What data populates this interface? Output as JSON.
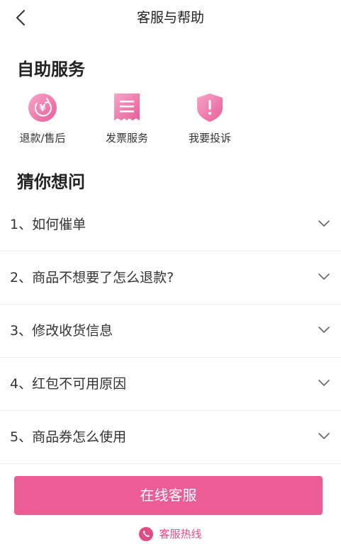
{
  "header": {
    "title": "客服与帮助"
  },
  "self_service": {
    "title": "自助服务",
    "items": [
      {
        "label": "退款/售后",
        "icon": "refund-icon"
      },
      {
        "label": "发票服务",
        "icon": "invoice-icon"
      },
      {
        "label": "我要投诉",
        "icon": "complaint-shield-icon"
      }
    ]
  },
  "faq": {
    "title": "猜你想问",
    "items": [
      {
        "text": "1、如何催单"
      },
      {
        "text": "2、商品不想要了怎么退款?"
      },
      {
        "text": "3、修改收货信息"
      },
      {
        "text": "4、红包不可用原因"
      },
      {
        "text": "5、商品券怎么使用"
      }
    ]
  },
  "bottom": {
    "online_service_label": "在线客服",
    "hotline_label": "客服热线"
  },
  "colors": {
    "accent": "#ea5e95",
    "accent_light": "#f49ac0",
    "text": "#333333"
  }
}
